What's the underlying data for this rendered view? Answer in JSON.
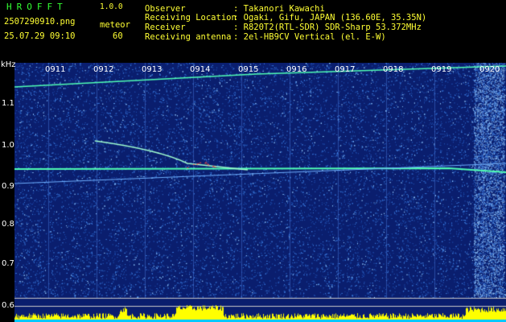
{
  "header": {
    "app_name": "HROFFT",
    "version": "1.0.0",
    "filename": "2507290910.png",
    "datetime": "25.07.29 09:10",
    "meteor_label": "meteor",
    "meteor_count": "60"
  },
  "info": [
    {
      "key": "Observer",
      "value": ": Takanori Kawachi"
    },
    {
      "key": "Receiving Location",
      "value": ": Ogaki, Gifu, JAPAN (136.60E, 35.35N)"
    },
    {
      "key": "Receiver",
      "value": ": R820T2(RTL-SDR) SDR-Sharp 53.372MHz"
    },
    {
      "key": "Receiving antenna",
      "value": ": 2el-HB9CV Vertical (el. E-W)"
    }
  ],
  "spectrogram": {
    "y_unit": "kHz",
    "y_labels": [
      "1.1",
      "1.0",
      "0.9",
      "0.8",
      "0.7",
      "0.6"
    ],
    "x_labels": [
      "0911",
      "0912",
      "0913",
      "0914",
      "0915",
      "0916",
      "0917",
      "0918",
      "0919",
      "0920"
    ],
    "colors": {
      "background": "#0a1e6e",
      "noise": "#3a7adc",
      "signal": "#50ffb4",
      "meteor": "#ff5040",
      "power": "#ffff00",
      "baseline": "#00c8ff"
    }
  }
}
